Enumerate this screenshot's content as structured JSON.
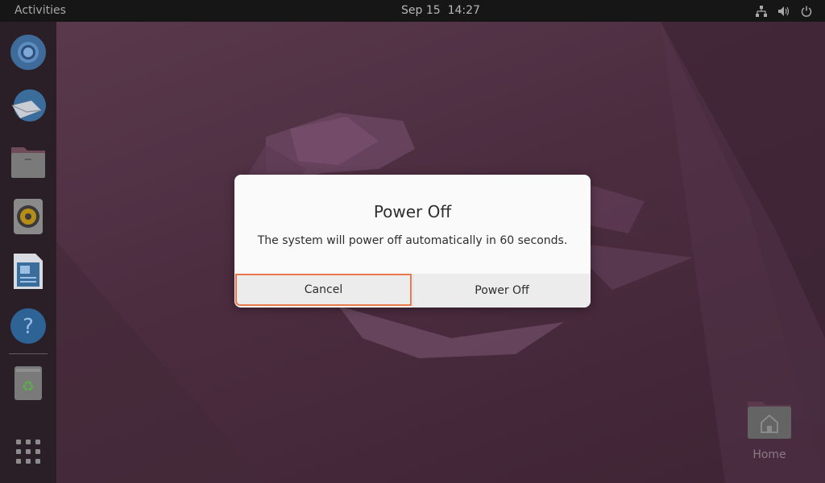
{
  "topbar": {
    "activities_label": "Activities",
    "date": "Sep 15",
    "time": "14:27",
    "tray_icons": [
      "network-icon",
      "volume-icon",
      "power-icon"
    ]
  },
  "dock": {
    "items": [
      {
        "name": "chromium",
        "icon": "browser-icon"
      },
      {
        "name": "thunderbird",
        "icon": "mail-icon"
      },
      {
        "name": "files",
        "icon": "folder-icon"
      },
      {
        "name": "rhythmbox",
        "icon": "speaker-icon"
      },
      {
        "name": "libreoffice-writer",
        "icon": "document-icon"
      },
      {
        "name": "help",
        "icon": "help-icon"
      },
      {
        "name": "trash",
        "icon": "trash-icon"
      },
      {
        "name": "show-apps",
        "icon": "app-grid-icon"
      }
    ]
  },
  "desktop": {
    "home_label": "Home"
  },
  "dialog": {
    "title": "Power Off",
    "message": "The system will power off automatically in 60 seconds.",
    "cancel_label": "Cancel",
    "confirm_label": "Power Off"
  },
  "colors": {
    "focus_border": "#e9784a",
    "dialog_bg": "#fafafa",
    "button_bg": "#ececec",
    "topbar_bg": "#161616"
  }
}
